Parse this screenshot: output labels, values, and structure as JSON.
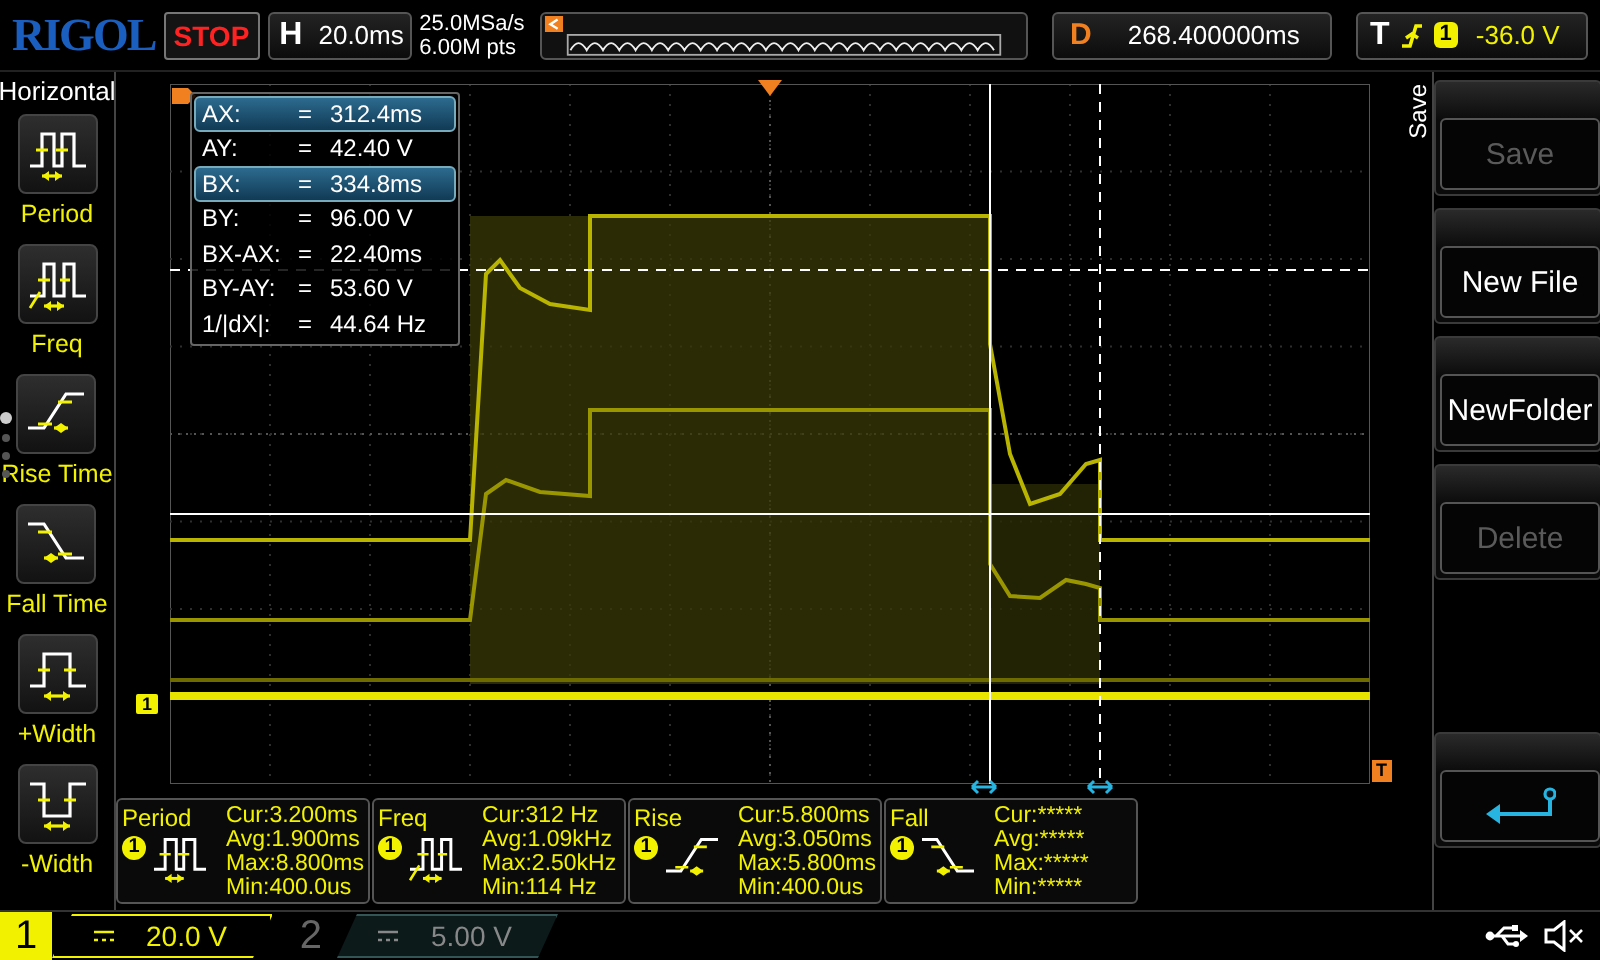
{
  "header": {
    "logo": "RIGOL",
    "run_state": "STOP",
    "timebase": {
      "label": "H",
      "value": "20.0ms"
    },
    "sample_rate": "25.0MSa/s",
    "memory_depth": "6.00M pts",
    "delay": {
      "label": "D",
      "value": "268.400000ms"
    },
    "trigger": {
      "label": "T",
      "source": "1",
      "level": "-36.0 V"
    }
  },
  "left_menu": {
    "title": "Horizontal",
    "pages": [
      {
        "selected": true
      },
      {
        "selected": false
      },
      {
        "selected": false
      },
      {
        "selected": false
      }
    ],
    "items": [
      {
        "label": "Period",
        "kind": "period"
      },
      {
        "label": "Freq",
        "kind": "freq"
      },
      {
        "label": "Rise Time",
        "kind": "rise"
      },
      {
        "label": "Fall Time",
        "kind": "fall"
      },
      {
        "label": "+Width",
        "kind": "pwidth"
      },
      {
        "label": "-Width",
        "kind": "nwidth"
      }
    ]
  },
  "plot": {
    "channel_marker": "1",
    "trigger_level_marker": "T",
    "cursor_readout": [
      {
        "label": "AX:",
        "eq": "=",
        "value": "312.4ms",
        "selected": true
      },
      {
        "label": "AY:",
        "eq": "=",
        "value": "42.40 V",
        "selected": false
      },
      {
        "label": "BX:",
        "eq": "=",
        "value": "334.8ms",
        "selected": true
      },
      {
        "label": "BY:",
        "eq": "=",
        "value": "96.00 V",
        "selected": false
      },
      {
        "label": "BX-AX:",
        "eq": "=",
        "value": "22.40ms",
        "selected": false
      },
      {
        "label": "BY-AY:",
        "eq": "=",
        "value": "53.60 V",
        "selected": false
      },
      {
        "label": "1/|dX|:",
        "eq": "=",
        "value": "44.64 Hz",
        "selected": false
      }
    ]
  },
  "measurements": [
    {
      "name": "Period",
      "source": "1",
      "kind": "period",
      "lines": [
        "Cur:3.200ms",
        "Avg:1.900ms",
        "Max:8.800ms",
        "Min:400.0us"
      ]
    },
    {
      "name": "Freq",
      "source": "1",
      "kind": "freq",
      "lines": [
        "Cur:312 Hz",
        "Avg:1.09kHz",
        "Max:2.50kHz",
        "Min:114 Hz"
      ]
    },
    {
      "name": "Rise",
      "source": "1",
      "kind": "rise",
      "lines": [
        "Cur:5.800ms",
        "Avg:3.050ms",
        "Max:5.800ms",
        "Min:400.0us"
      ]
    },
    {
      "name": "Fall",
      "source": "1",
      "kind": "fall",
      "lines": [
        "Cur:*****",
        "Avg:*****",
        "Max:*****",
        "Min:*****"
      ]
    }
  ],
  "right_menu": {
    "title": "Save",
    "buttons": [
      {
        "label": "Save",
        "disabled": true
      },
      {
        "label": "New File",
        "disabled": false
      },
      {
        "label": "NewFolder",
        "disabled": false
      },
      {
        "label": "Delete",
        "disabled": true
      }
    ]
  },
  "channels": [
    {
      "number": "1",
      "scale": "20.0 V",
      "on": true
    },
    {
      "number": "2",
      "scale": "5.00 V",
      "on": false
    }
  ]
}
